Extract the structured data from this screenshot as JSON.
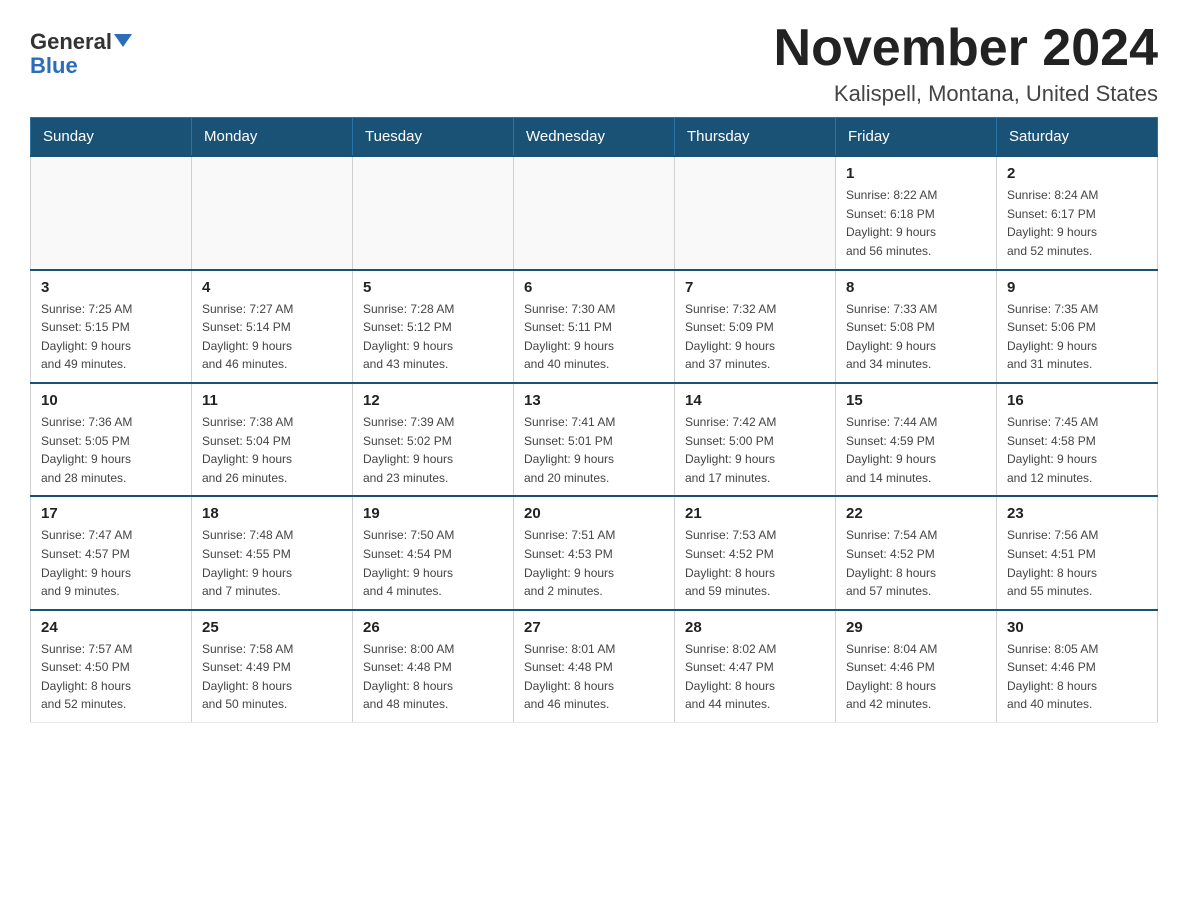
{
  "header": {
    "logo_line1": "General",
    "logo_line2": "Blue",
    "title": "November 2024",
    "subtitle": "Kalispell, Montana, United States"
  },
  "weekdays": [
    "Sunday",
    "Monday",
    "Tuesday",
    "Wednesday",
    "Thursday",
    "Friday",
    "Saturday"
  ],
  "weeks": [
    [
      {
        "day": "",
        "info": ""
      },
      {
        "day": "",
        "info": ""
      },
      {
        "day": "",
        "info": ""
      },
      {
        "day": "",
        "info": ""
      },
      {
        "day": "",
        "info": ""
      },
      {
        "day": "1",
        "info": "Sunrise: 8:22 AM\nSunset: 6:18 PM\nDaylight: 9 hours\nand 56 minutes."
      },
      {
        "day": "2",
        "info": "Sunrise: 8:24 AM\nSunset: 6:17 PM\nDaylight: 9 hours\nand 52 minutes."
      }
    ],
    [
      {
        "day": "3",
        "info": "Sunrise: 7:25 AM\nSunset: 5:15 PM\nDaylight: 9 hours\nand 49 minutes."
      },
      {
        "day": "4",
        "info": "Sunrise: 7:27 AM\nSunset: 5:14 PM\nDaylight: 9 hours\nand 46 minutes."
      },
      {
        "day": "5",
        "info": "Sunrise: 7:28 AM\nSunset: 5:12 PM\nDaylight: 9 hours\nand 43 minutes."
      },
      {
        "day": "6",
        "info": "Sunrise: 7:30 AM\nSunset: 5:11 PM\nDaylight: 9 hours\nand 40 minutes."
      },
      {
        "day": "7",
        "info": "Sunrise: 7:32 AM\nSunset: 5:09 PM\nDaylight: 9 hours\nand 37 minutes."
      },
      {
        "day": "8",
        "info": "Sunrise: 7:33 AM\nSunset: 5:08 PM\nDaylight: 9 hours\nand 34 minutes."
      },
      {
        "day": "9",
        "info": "Sunrise: 7:35 AM\nSunset: 5:06 PM\nDaylight: 9 hours\nand 31 minutes."
      }
    ],
    [
      {
        "day": "10",
        "info": "Sunrise: 7:36 AM\nSunset: 5:05 PM\nDaylight: 9 hours\nand 28 minutes."
      },
      {
        "day": "11",
        "info": "Sunrise: 7:38 AM\nSunset: 5:04 PM\nDaylight: 9 hours\nand 26 minutes."
      },
      {
        "day": "12",
        "info": "Sunrise: 7:39 AM\nSunset: 5:02 PM\nDaylight: 9 hours\nand 23 minutes."
      },
      {
        "day": "13",
        "info": "Sunrise: 7:41 AM\nSunset: 5:01 PM\nDaylight: 9 hours\nand 20 minutes."
      },
      {
        "day": "14",
        "info": "Sunrise: 7:42 AM\nSunset: 5:00 PM\nDaylight: 9 hours\nand 17 minutes."
      },
      {
        "day": "15",
        "info": "Sunrise: 7:44 AM\nSunset: 4:59 PM\nDaylight: 9 hours\nand 14 minutes."
      },
      {
        "day": "16",
        "info": "Sunrise: 7:45 AM\nSunset: 4:58 PM\nDaylight: 9 hours\nand 12 minutes."
      }
    ],
    [
      {
        "day": "17",
        "info": "Sunrise: 7:47 AM\nSunset: 4:57 PM\nDaylight: 9 hours\nand 9 minutes."
      },
      {
        "day": "18",
        "info": "Sunrise: 7:48 AM\nSunset: 4:55 PM\nDaylight: 9 hours\nand 7 minutes."
      },
      {
        "day": "19",
        "info": "Sunrise: 7:50 AM\nSunset: 4:54 PM\nDaylight: 9 hours\nand 4 minutes."
      },
      {
        "day": "20",
        "info": "Sunrise: 7:51 AM\nSunset: 4:53 PM\nDaylight: 9 hours\nand 2 minutes."
      },
      {
        "day": "21",
        "info": "Sunrise: 7:53 AM\nSunset: 4:52 PM\nDaylight: 8 hours\nand 59 minutes."
      },
      {
        "day": "22",
        "info": "Sunrise: 7:54 AM\nSunset: 4:52 PM\nDaylight: 8 hours\nand 57 minutes."
      },
      {
        "day": "23",
        "info": "Sunrise: 7:56 AM\nSunset: 4:51 PM\nDaylight: 8 hours\nand 55 minutes."
      }
    ],
    [
      {
        "day": "24",
        "info": "Sunrise: 7:57 AM\nSunset: 4:50 PM\nDaylight: 8 hours\nand 52 minutes."
      },
      {
        "day": "25",
        "info": "Sunrise: 7:58 AM\nSunset: 4:49 PM\nDaylight: 8 hours\nand 50 minutes."
      },
      {
        "day": "26",
        "info": "Sunrise: 8:00 AM\nSunset: 4:48 PM\nDaylight: 8 hours\nand 48 minutes."
      },
      {
        "day": "27",
        "info": "Sunrise: 8:01 AM\nSunset: 4:48 PM\nDaylight: 8 hours\nand 46 minutes."
      },
      {
        "day": "28",
        "info": "Sunrise: 8:02 AM\nSunset: 4:47 PM\nDaylight: 8 hours\nand 44 minutes."
      },
      {
        "day": "29",
        "info": "Sunrise: 8:04 AM\nSunset: 4:46 PM\nDaylight: 8 hours\nand 42 minutes."
      },
      {
        "day": "30",
        "info": "Sunrise: 8:05 AM\nSunset: 4:46 PM\nDaylight: 8 hours\nand 40 minutes."
      }
    ]
  ]
}
